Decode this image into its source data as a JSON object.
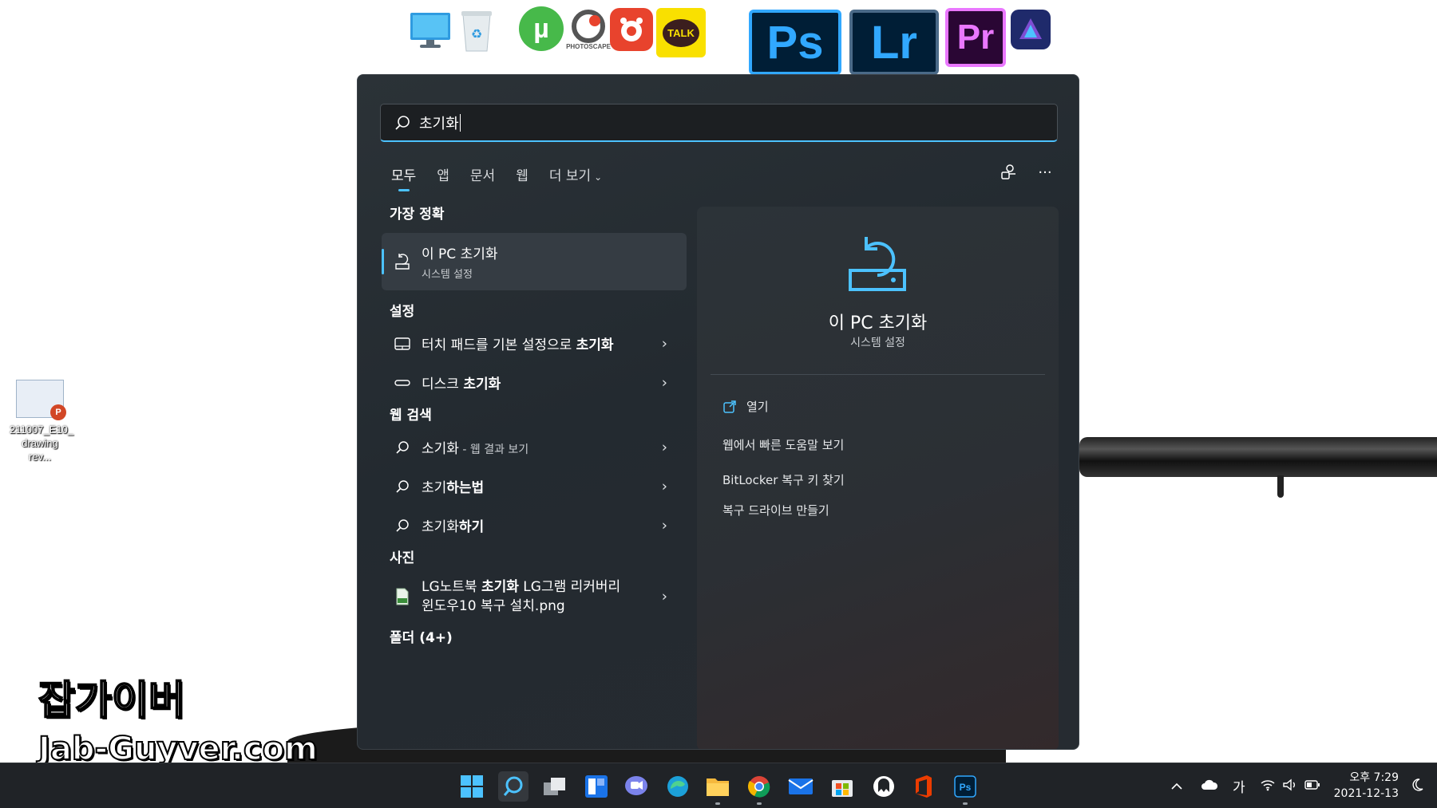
{
  "desktop": {
    "top_icons": [
      {
        "name": "this-pc-icon",
        "color": "#3aa3e8"
      },
      {
        "name": "recycle-bin-icon",
        "color": "#cfd8dc"
      },
      {
        "name": "utorrent-icon",
        "label": "µ",
        "color": "#47b94a"
      },
      {
        "name": "photoscape-icon",
        "label": "PHOTOSCAPE",
        "color": "#444444"
      },
      {
        "name": "gom-player-icon",
        "color": "#e8432d"
      },
      {
        "name": "kakaotalk-icon",
        "label": "TALK",
        "color": "#f9e000"
      },
      {
        "name": "photoshop-icon",
        "label": "Ps",
        "color": "#31a8ff"
      },
      {
        "name": "lightroom-icon",
        "label": "Lr",
        "color": "#31a8ff"
      },
      {
        "name": "premiere-icon",
        "label": "Pr",
        "color": "#ea77ff"
      },
      {
        "name": "affinity-icon",
        "color": "#7e4dd2"
      }
    ],
    "file": {
      "name_line1": "211007_E10_",
      "name_line2": "drawing rev..."
    },
    "watermark": {
      "line1": "잡가이버",
      "line2": "Jab-Guyver.com"
    }
  },
  "search": {
    "query": "초기화",
    "tabs": [
      {
        "label": "모두",
        "active": true
      },
      {
        "label": "앱"
      },
      {
        "label": "문서"
      },
      {
        "label": "웹"
      },
      {
        "label": "더 보기"
      }
    ],
    "more_chevron": "⌄",
    "more_options": "···"
  },
  "results": {
    "best_match_header": "가장 정확",
    "best_match": {
      "title": "이 PC 초기화",
      "subtitle": "시스템 설정"
    },
    "settings_header": "설정",
    "settings": [
      {
        "prefix": "터치 패드를 기본 설정으로 ",
        "bold": "초기화"
      },
      {
        "prefix": "디스크 ",
        "bold": "초기화"
      }
    ],
    "web_header": "웹 검색",
    "web": [
      {
        "prefix": "소기화",
        "bold": "",
        "sub": " - 웹 결과 보기"
      },
      {
        "prefix": "초기",
        "bold": "하는법",
        "sub": ""
      },
      {
        "prefix": "초기화",
        "bold": "하기",
        "sub": ""
      }
    ],
    "photos_header": "사진",
    "photo": {
      "prefix": "LG노트북 ",
      "bold": "초기화",
      "suffix": " LG그램 리커버리",
      "line2": "윈도우10 복구 설치.png"
    },
    "folders_header": "폴더 (4+)"
  },
  "preview": {
    "title": "이 PC 초기화",
    "subtitle": "시스템 설정",
    "actions": [
      {
        "label": "열기"
      },
      {
        "label": "웹에서 빠른 도움말 보기"
      },
      {
        "label": "BitLocker 복구 키 찾기"
      },
      {
        "label": "복구 드라이브 만들기"
      }
    ],
    "accent": "#4cc2ff"
  },
  "taskbar": {
    "apps": [
      "start-icon",
      "search-icon",
      "task-view-icon",
      "widgets-icon",
      "teams-chat-icon",
      "edge-icon",
      "file-explorer-icon",
      "chrome-icon",
      "mail-icon",
      "store-icon",
      "app-icon",
      "office-icon",
      "photoshop-icon"
    ],
    "tray": {
      "ime": "가"
    },
    "clock": {
      "time": "오후 7:29",
      "date": "2021-12-13"
    }
  }
}
